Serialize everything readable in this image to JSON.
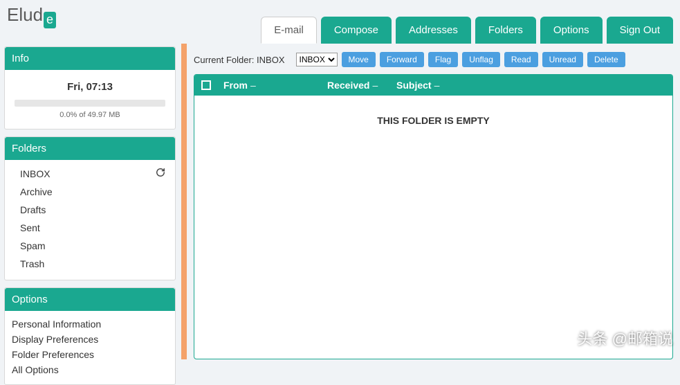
{
  "logo": {
    "text_left": "Elud",
    "text_box": "e"
  },
  "tabs": {
    "email": "E-mail",
    "compose": "Compose",
    "addresses": "Addresses",
    "folders": "Folders",
    "options": "Options",
    "signout": "Sign Out"
  },
  "sidebar": {
    "info": {
      "title": "Info",
      "time": "Fri, 07:13",
      "usage": "0.0% of 49.97 MB"
    },
    "folders": {
      "title": "Folders",
      "items": [
        "INBOX",
        "Archive",
        "Drafts",
        "Sent",
        "Spam",
        "Trash"
      ]
    },
    "options": {
      "title": "Options",
      "items": [
        "Personal Information",
        "Display Preferences",
        "Folder Preferences",
        "All Options"
      ]
    }
  },
  "main": {
    "current_folder_label": "Current Folder: INBOX",
    "folder_select": "INBOX",
    "buttons": {
      "move": "Move",
      "forward": "Forward",
      "flag": "Flag",
      "unflag": "Unflag",
      "read": "Read",
      "unread": "Unread",
      "delete": "Delete"
    },
    "columns": {
      "from": "From",
      "received": "Received",
      "subject": "Subject"
    },
    "empty_message": "THIS FOLDER IS EMPTY"
  },
  "watermark": "头条 @邮箱说"
}
